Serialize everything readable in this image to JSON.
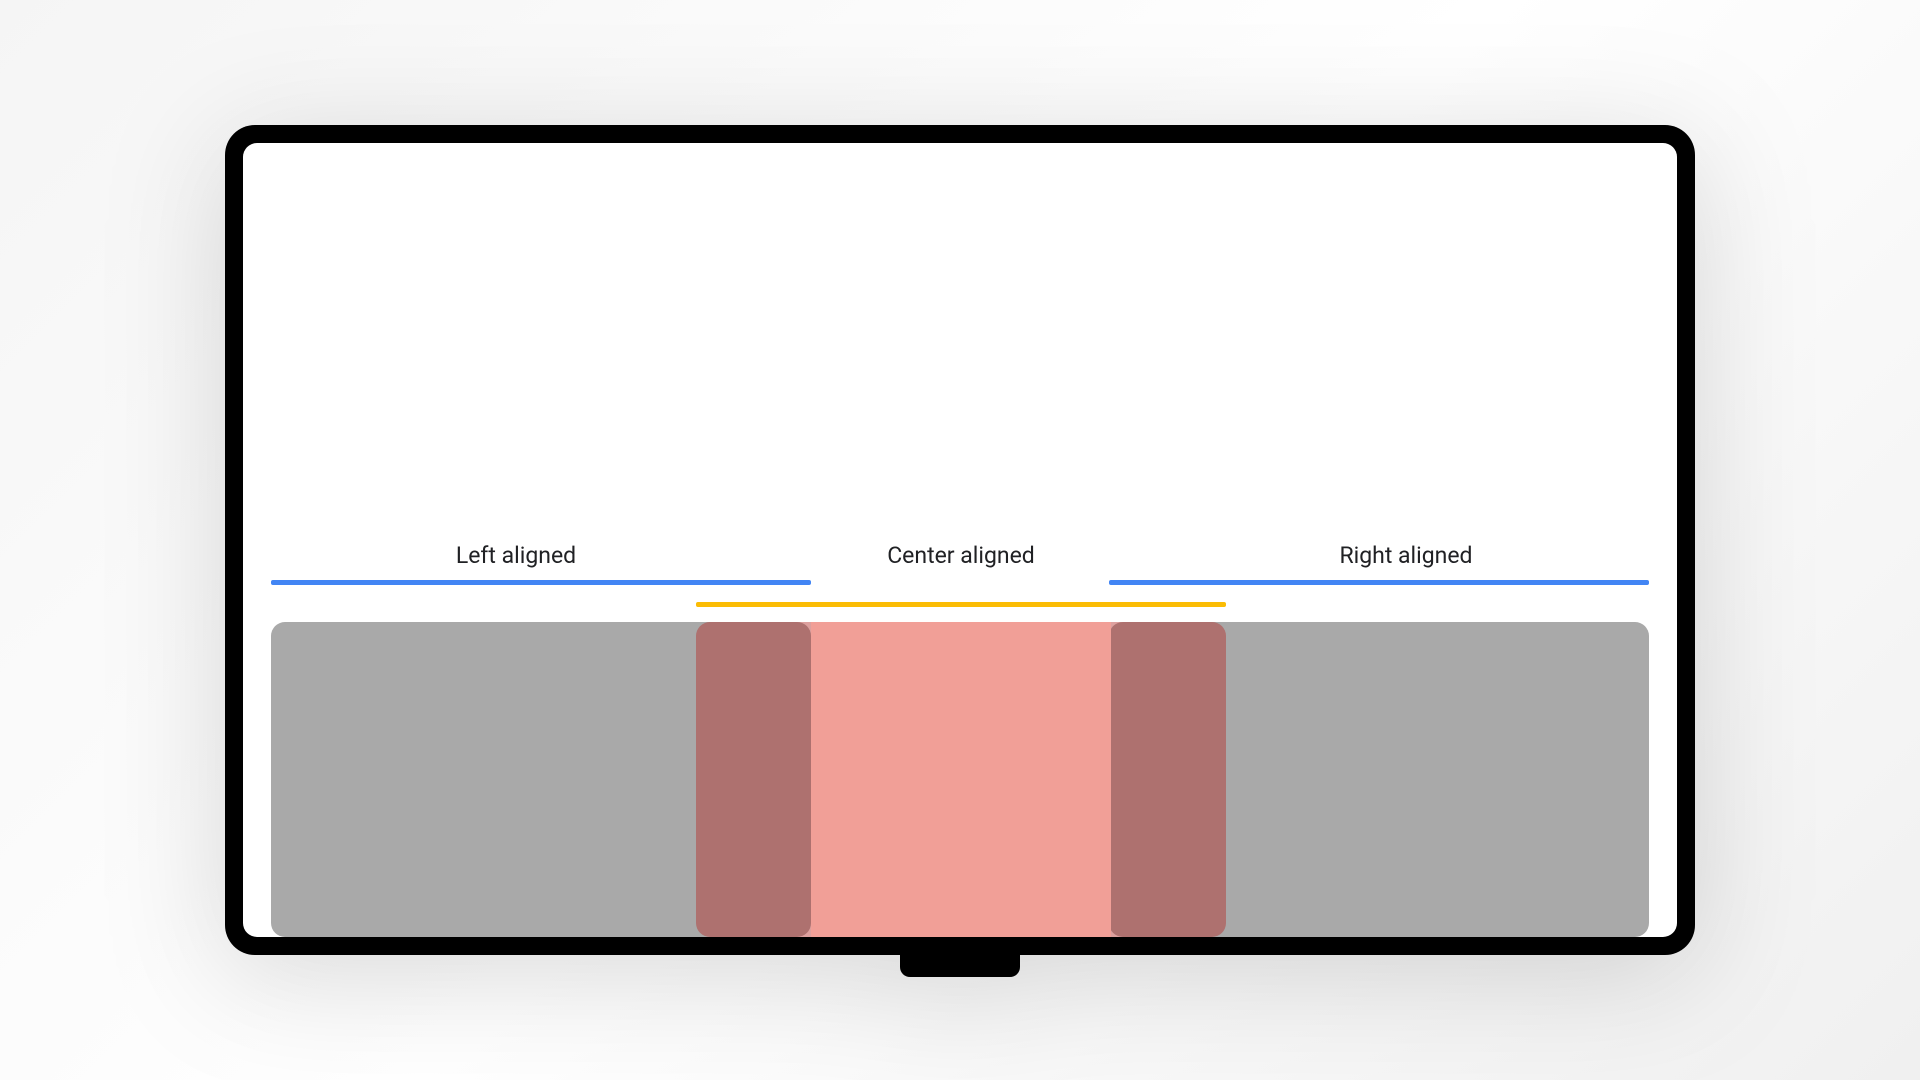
{
  "diagram": {
    "labels": {
      "left": "Left aligned",
      "center": "Center aligned",
      "right": "Right aligned"
    },
    "colors": {
      "blue_line": "#4285f4",
      "yellow_line": "#fbbc04",
      "gray_card": "#a9a9a9",
      "red_card": "#f19f97",
      "red_overlap": "#c15e57"
    }
  }
}
